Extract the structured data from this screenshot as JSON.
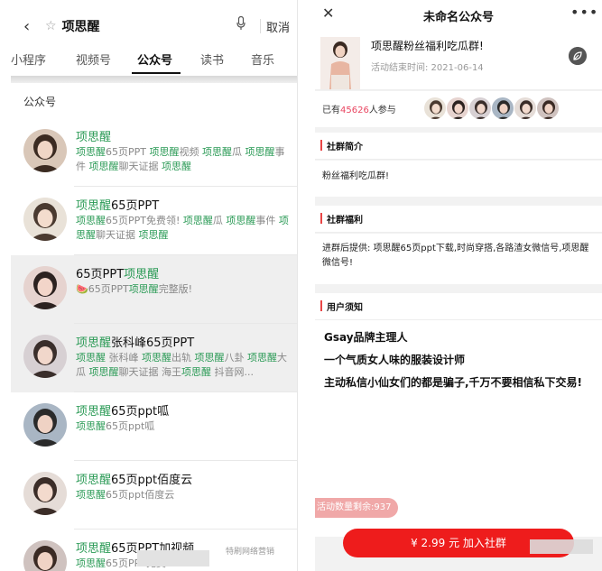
{
  "left": {
    "search": {
      "query": "项思醒",
      "cancel": "取消"
    },
    "tabs": [
      "小程序",
      "视频号",
      "公众号",
      "读书",
      "音乐"
    ],
    "active_tab": "公众号",
    "section_title": "公众号",
    "results": [
      {
        "name_parts": [
          "项思醒",
          ""
        ],
        "desc": "项思醒65页PPT 项思醒视频 项思醒瓜 项思醒事件 项思醒聊天证据 项思醒",
        "shaded": false
      },
      {
        "name_parts": [
          "项思醒",
          "65页PPT"
        ],
        "desc": "项思醒65页PPT免费领! 项思醒瓜 项思醒事件 项思醒聊天证据 项思醒",
        "shaded": false
      },
      {
        "name_parts": [
          "65页PPT",
          "项思醒"
        ],
        "desc": "🍉65页PPT项思醒完整版!",
        "shaded": true
      },
      {
        "name_parts": [
          "项思醒",
          "张科峰65页PPT"
        ],
        "desc": "项思醒 张科峰 项思醒出轨 项思醒八卦 项思醒大瓜 项思醒聊天证据 海王项思醒 抖音网...",
        "shaded": true
      },
      {
        "name_parts": [
          "项思醒",
          "65页ppt呱"
        ],
        "desc": "项思醒65页ppt呱",
        "shaded": false
      },
      {
        "name_parts": [
          "项思醒",
          "65页ppt佰度云"
        ],
        "desc": "项思醒65页ppt佰度云",
        "shaded": false
      },
      {
        "name_parts": [
          "项思醒",
          "65页PPT加视频"
        ],
        "desc": "项思醒65页PPT免费",
        "shaded": false
      }
    ],
    "watermark": "特刷网络营销"
  },
  "right": {
    "title": "未命名公众号",
    "group": {
      "name": "项思醒粉丝福利吃瓜群!",
      "date": "活动结束时间: 2021-06-14"
    },
    "join": {
      "prefix": "已有",
      "count": "45626",
      "suffix": "人参与"
    },
    "intro": {
      "heading": "社群简介",
      "text": "粉丝福利吃瓜群!"
    },
    "benefit": {
      "heading": "社群福利",
      "text": "进群后提供: 项思醒65页ppt下载,时尚穿搭,各路渣女微信号,项思醒微信号!"
    },
    "notice": {
      "heading": "用户须知",
      "lines": [
        "Gsay品牌主理人",
        "一个气质女人味的服装设计师",
        "主动私信小仙女们的都是骗子,千万不要相信私下交易!"
      ]
    },
    "remaining": "活动数量剩余:937",
    "button": "¥ 2.99 元 加入社群"
  }
}
